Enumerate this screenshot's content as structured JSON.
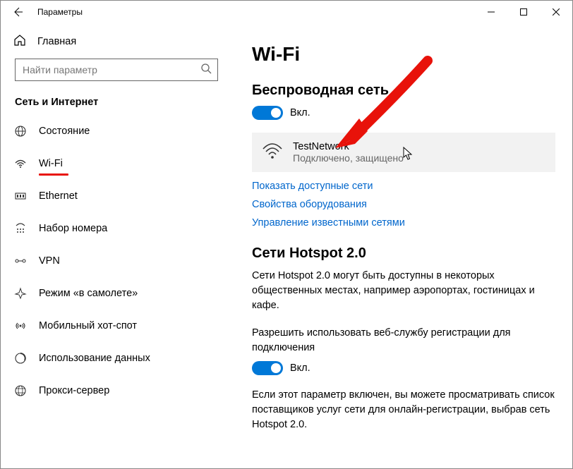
{
  "titlebar": {
    "title": "Параметры"
  },
  "sidebar": {
    "home": "Главная",
    "search_placeholder": "Найти параметр",
    "category": "Сеть и Интернет",
    "items": [
      {
        "label": "Состояние"
      },
      {
        "label": "Wi-Fi"
      },
      {
        "label": "Ethernet"
      },
      {
        "label": "Набор номера"
      },
      {
        "label": "VPN"
      },
      {
        "label": "Режим «в самолете»"
      },
      {
        "label": "Мобильный хот-спот"
      },
      {
        "label": "Использование данных"
      },
      {
        "label": "Прокси-сервер"
      }
    ]
  },
  "page": {
    "title": "Wi-Fi",
    "wireless_heading": "Беспроводная сеть",
    "toggle_on": "Вкл.",
    "network": {
      "name": "TestNetwork",
      "status": "Подключено, защищено"
    },
    "links": {
      "show": "Показать доступные сети",
      "hardware": "Свойства оборудования",
      "manage": "Управление известными сетями"
    },
    "hotspot_heading": "Сети Hotspot 2.0",
    "hotspot_desc": "Сети Hotspot 2.0 могут быть доступны в некоторых общественных местах, например аэропортах, гостиницах и кафе.",
    "hotspot_allow": "Разрешить использовать веб-службу регистрации для подключения",
    "hotspot_note": "Если этот параметр включен, вы можете просматривать список поставщиков услуг сети для онлайн-регистрации, выбрав сеть Hotspot 2.0."
  }
}
